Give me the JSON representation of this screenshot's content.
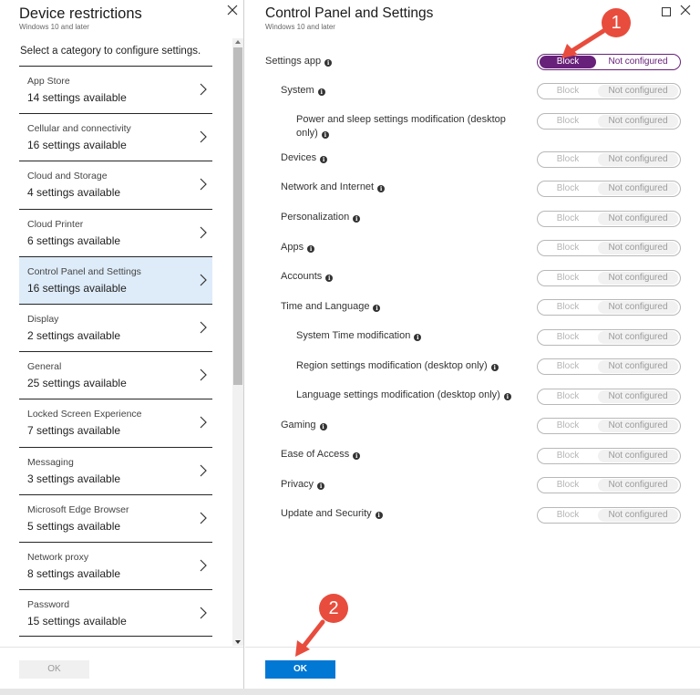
{
  "left_blade": {
    "title": "Device restrictions",
    "subtitle": "Windows 10 and later",
    "intro": "Select a category to configure settings.",
    "categories": [
      {
        "name": "App Store",
        "count": "14 settings available"
      },
      {
        "name": "Cellular and connectivity",
        "count": "16 settings available"
      },
      {
        "name": "Cloud and Storage",
        "count": "4 settings available"
      },
      {
        "name": "Cloud Printer",
        "count": "6 settings available"
      },
      {
        "name": "Control Panel and Settings",
        "count": "16 settings available"
      },
      {
        "name": "Display",
        "count": "2 settings available"
      },
      {
        "name": "General",
        "count": "25 settings available"
      },
      {
        "name": "Locked Screen Experience",
        "count": "7 settings available"
      },
      {
        "name": "Messaging",
        "count": "3 settings available"
      },
      {
        "name": "Microsoft Edge Browser",
        "count": "5 settings available"
      },
      {
        "name": "Network proxy",
        "count": "8 settings available"
      },
      {
        "name": "Password",
        "count": "15 settings available"
      }
    ],
    "selected_category": "Control Panel and Settings",
    "ok_label": "OK"
  },
  "right_blade": {
    "title": "Control Panel and Settings",
    "subtitle": "Windows 10 and later",
    "settings": [
      {
        "label": "Settings app",
        "value": "Block"
      },
      {
        "label": "System",
        "value": "Not configured"
      },
      {
        "label": "Power and sleep settings modification (desktop",
        "label_line2": "only)",
        "value": "Not configured"
      },
      {
        "label": "Devices",
        "value": "Not configured"
      },
      {
        "label": "Network and Internet",
        "value": "Not configured"
      },
      {
        "label": "Personalization",
        "value": "Not configured"
      },
      {
        "label": "Apps",
        "value": "Not configured"
      },
      {
        "label": "Accounts",
        "value": "Not configured"
      },
      {
        "label": "Time and Language",
        "value": "Not configured"
      },
      {
        "label": "System Time modification",
        "value": "Not configured"
      },
      {
        "label": "Region settings modification (desktop only)",
        "value": "Not configured"
      },
      {
        "label": "Language settings modification (desktop only)",
        "value": "Not configured"
      },
      {
        "label": "Gaming",
        "value": "Not configured"
      },
      {
        "label": "Ease of Access",
        "value": "Not configured"
      },
      {
        "label": "Privacy",
        "value": "Not configured"
      },
      {
        "label": "Update and Security",
        "value": "Not configured"
      }
    ],
    "toggle_options": {
      "block": "Block",
      "not_configured": "Not configured"
    },
    "ok_label": "OK"
  },
  "info_glyph": "i",
  "annotations": {
    "step1": "1",
    "step2": "2"
  },
  "colors": {
    "accent": "#68217a",
    "primary_button": "#0078d4",
    "selected_row": "#deecf9",
    "annotation": "#e84c3d"
  }
}
